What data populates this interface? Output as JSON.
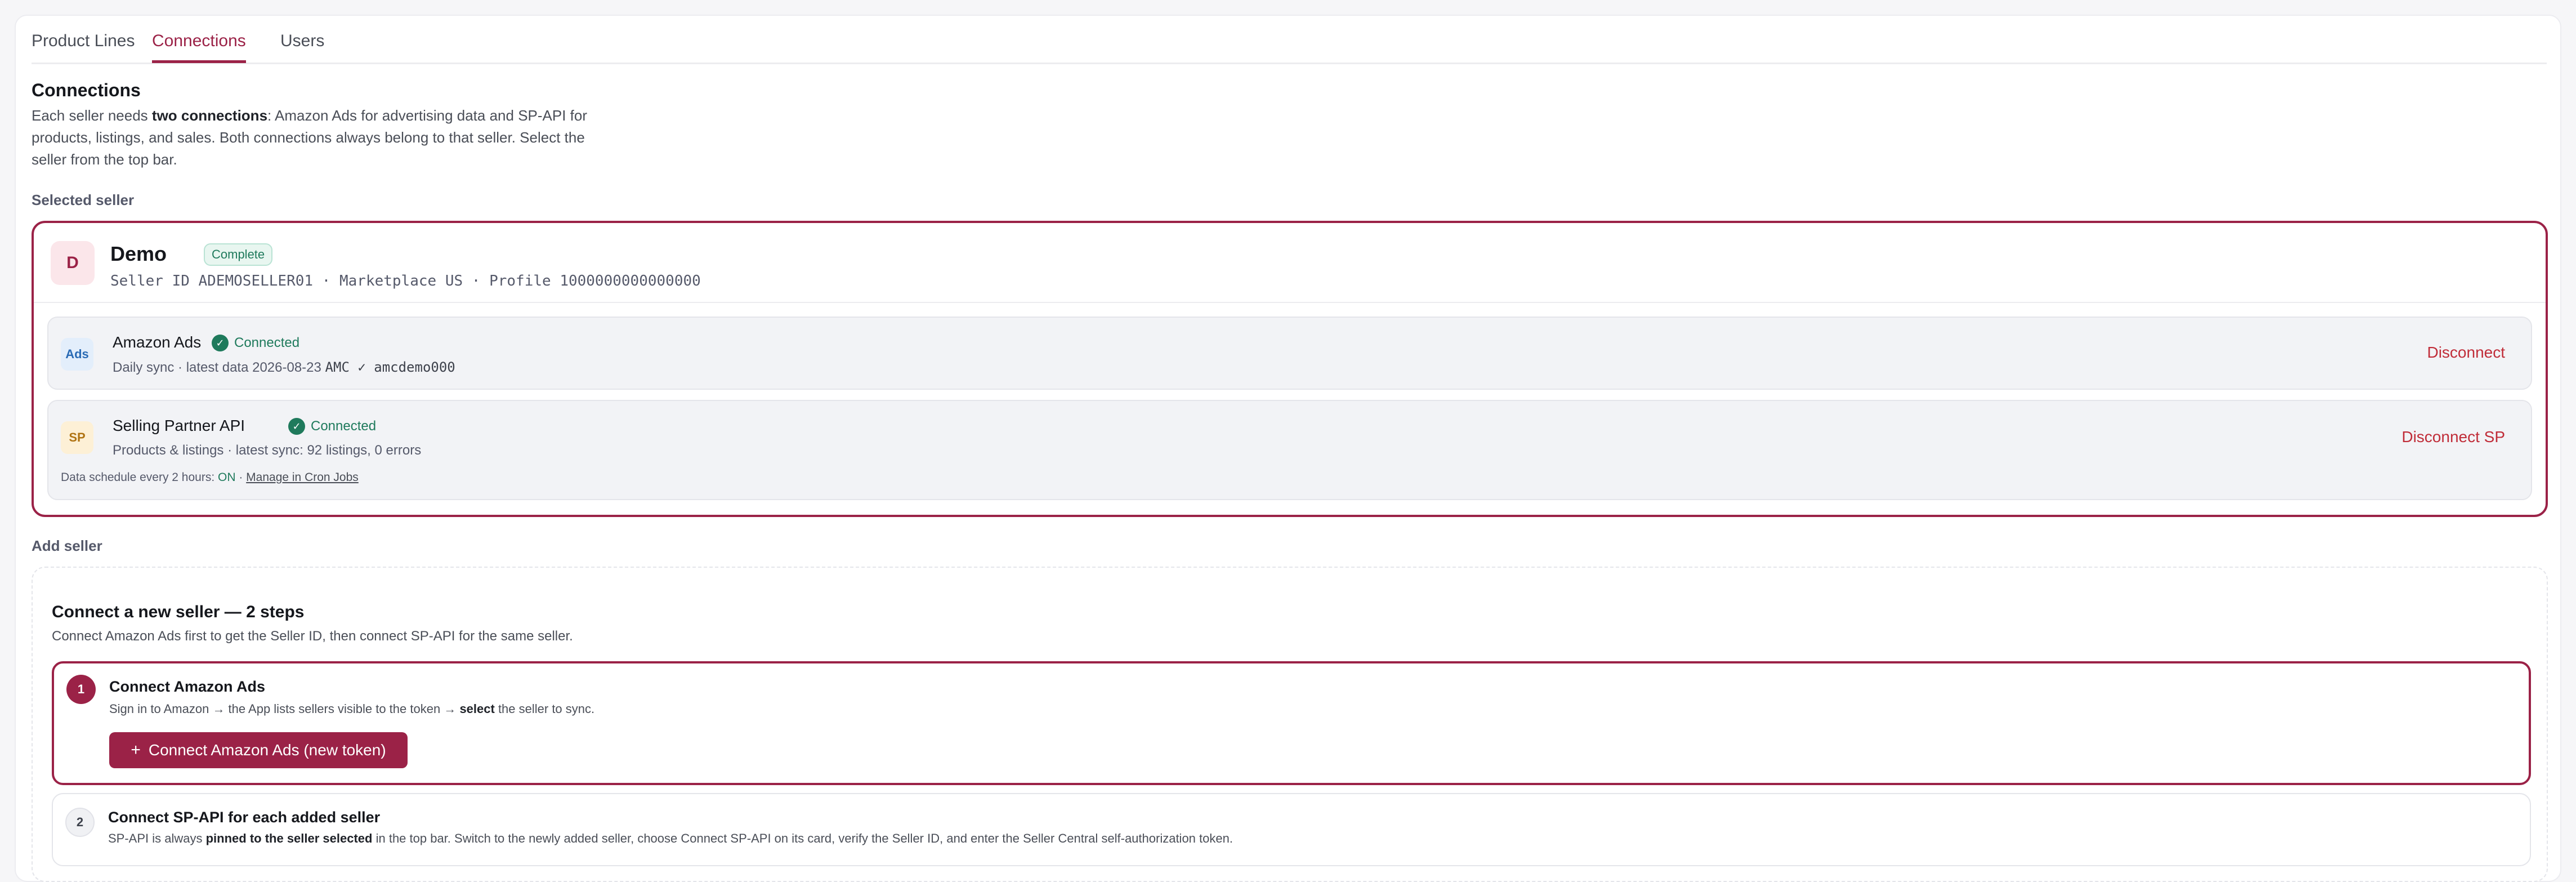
{
  "tabs": [
    {
      "label": "Product Lines",
      "active": false
    },
    {
      "label": "Connections",
      "active": true
    },
    {
      "label": "Users",
      "active": false
    }
  ],
  "connections": {
    "title": "Connections",
    "intro_prefix": "Each seller needs ",
    "intro_bold": "two connections",
    "intro_suffix": ": Amazon Ads for advertising data and SP-API for products, listings, and sales. Both connections always belong to that seller. Select the seller from the top bar."
  },
  "selected_seller": {
    "section_label": "Selected seller",
    "avatar_letter": "D",
    "name": "Demo",
    "badge": "Complete",
    "meta": "Seller ID ADEMOSELLER01 · Marketplace US · Profile 1000000000000000",
    "amazon_ads": {
      "icon_text": "Ads",
      "title": "Amazon Ads",
      "status": "Connected",
      "sub_text": "Daily sync · latest data 2026-08-23",
      "sub_mono": "AMC ✓ amcdemo000",
      "action": "Disconnect"
    },
    "sp_api": {
      "icon_text": "SP",
      "title": "Selling Partner API",
      "status": "Connected",
      "sub_text": "Products & listings · latest sync: 92 listings, 0 errors",
      "action": "Disconnect SP",
      "schedule_prefix": "Data schedule every 2 hours: ",
      "schedule_on": "ON",
      "schedule_sep": " · ",
      "schedule_link": "Manage in Cron Jobs"
    }
  },
  "add_seller": {
    "section_label": "Add seller",
    "title": "Connect a new seller — 2 steps",
    "subtitle": "Connect Amazon Ads first to get the Seller ID, then connect SP-API for the same seller.",
    "step1": {
      "num": "1",
      "title": "Connect Amazon Ads",
      "sub_prefix": "Sign in to Amazon → the App lists sellers visible to the token → ",
      "sub_bold": "select",
      "sub_suffix": " the seller to sync.",
      "button": "Connect Amazon Ads (new token)"
    },
    "step2": {
      "num": "2",
      "title": "Connect SP-API for each added seller",
      "sub_prefix": "SP-API is always ",
      "sub_bold": "pinned to the seller selected",
      "sub_suffix": " in the top bar. Switch to the newly added seller, choose Connect SP-API on its card, verify the Seller ID, and enter the Seller Central self-authorization token."
    }
  },
  "colors": {
    "accent": "#9b2247",
    "success": "#1f7a5c",
    "danger": "#c02c38"
  },
  "icons": {
    "connected": "check-circle-icon",
    "add": "plus-icon"
  }
}
